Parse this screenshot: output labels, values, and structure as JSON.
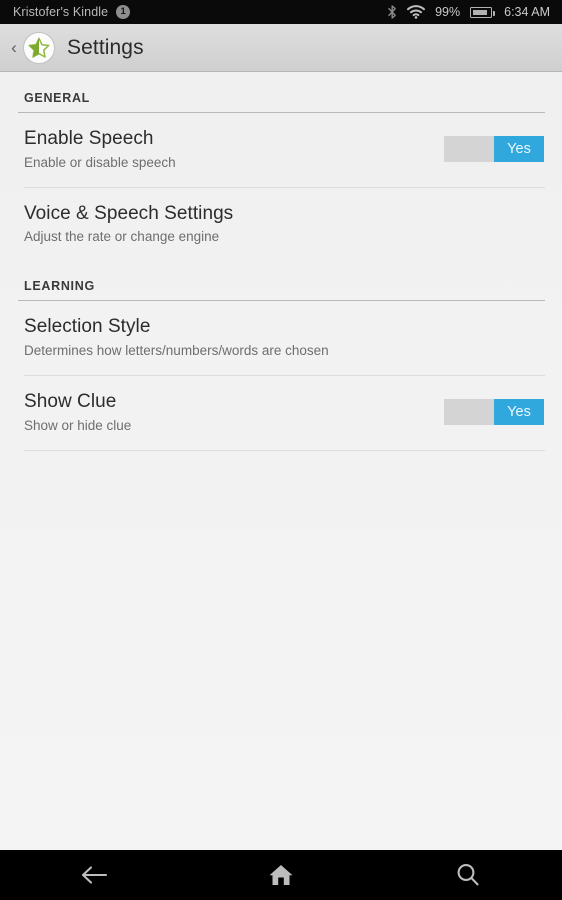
{
  "status_bar": {
    "device_name": "Kristofer's Kindle",
    "notification_count": "1",
    "bluetooth_icon": "bluetooth-icon",
    "wifi_icon": "wifi-icon",
    "battery_percent": "99%",
    "battery_icon": "battery-icon",
    "time": "6:34 AM"
  },
  "action_bar": {
    "back_caret": "‹",
    "app_icon": "half-star-icon",
    "title": "Settings"
  },
  "sections": [
    {
      "header": "GENERAL",
      "items": [
        {
          "title": "Enable Speech",
          "summary": "Enable or disable speech",
          "switch": {
            "present": true,
            "value": "Yes",
            "state": "on"
          }
        },
        {
          "title": "Voice & Speech Settings",
          "summary": "Adjust the rate or change engine",
          "switch": {
            "present": false,
            "value": "",
            "state": ""
          }
        }
      ]
    },
    {
      "header": "LEARNING",
      "items": [
        {
          "title": "Selection Style",
          "summary": "Determines how letters/numbers/words are chosen",
          "switch": {
            "present": false,
            "value": "",
            "state": ""
          }
        },
        {
          "title": "Show Clue",
          "summary": "Show or hide clue",
          "switch": {
            "present": true,
            "value": "Yes",
            "state": "on"
          }
        }
      ]
    }
  ],
  "nav_bar": {
    "buttons": [
      {
        "name": "back-icon",
        "label": "Back"
      },
      {
        "name": "home-icon",
        "label": "Home"
      },
      {
        "name": "search-icon",
        "label": "Search"
      }
    ]
  },
  "colors": {
    "accent_blue": "#31a8dd",
    "switch_off": "#d4d4d4",
    "star_green": "#7da92c",
    "page_bg": "#f2f2f2",
    "action_bar_bg": "#d6d6d6",
    "status_bar_bg": "#0a0a0a",
    "nav_bar_bg": "#000000"
  }
}
